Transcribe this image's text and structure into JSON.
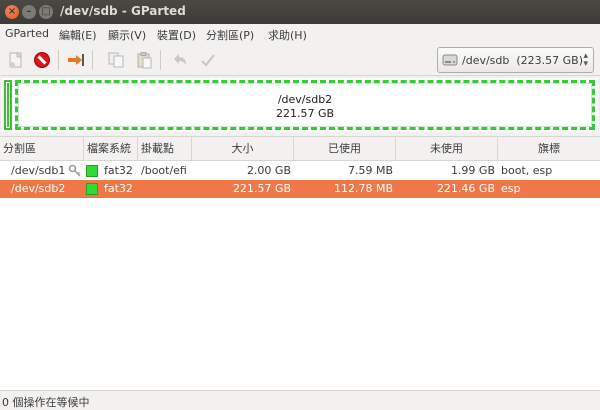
{
  "window": {
    "title": "/dev/sdb - GParted",
    "buttons": {
      "close": "×",
      "minimize": "–",
      "maximize": "□"
    }
  },
  "menu": [
    "GParted",
    "編輯(E)",
    "顯示(V)",
    "裝置(D)",
    "分割區(P)",
    "求助(H)"
  ],
  "toolbar": {
    "icons": [
      "new-partition-icon",
      "delete-partition-icon",
      "resize-move-icon",
      "copy-icon",
      "paste-icon",
      "undo-icon",
      "apply-icon"
    ]
  },
  "device_selector": {
    "icon": "harddisk-icon",
    "label": "/dev/sdb  (223.57 GB)"
  },
  "graph": {
    "label_name": "/dev/sdb2",
    "label_size": "221.57 GB"
  },
  "table": {
    "headers": [
      "分割區",
      "檔案系統",
      "掛載點",
      "大小",
      "已使用",
      "未使用",
      "旗標"
    ],
    "rows": [
      {
        "partition": "/dev/sdb1",
        "fs": "fat32",
        "mount": "/boot/efi",
        "size": "2.00 GB",
        "used": "7.59 MB",
        "unused": "1.99 GB",
        "flags": "boot, esp",
        "selected": false,
        "locked": true
      },
      {
        "partition": "/dev/sdb2",
        "fs": "fat32",
        "mount": "",
        "size": "221.57 GB",
        "used": "112.78 MB",
        "unused": "221.46 GB",
        "flags": "esp",
        "selected": true,
        "locked": false
      }
    ]
  },
  "status": "0 個操作在等候中",
  "colors": {
    "fat32": "#33d933",
    "selection": "#f07746",
    "titlebar": "#3c3b37"
  }
}
